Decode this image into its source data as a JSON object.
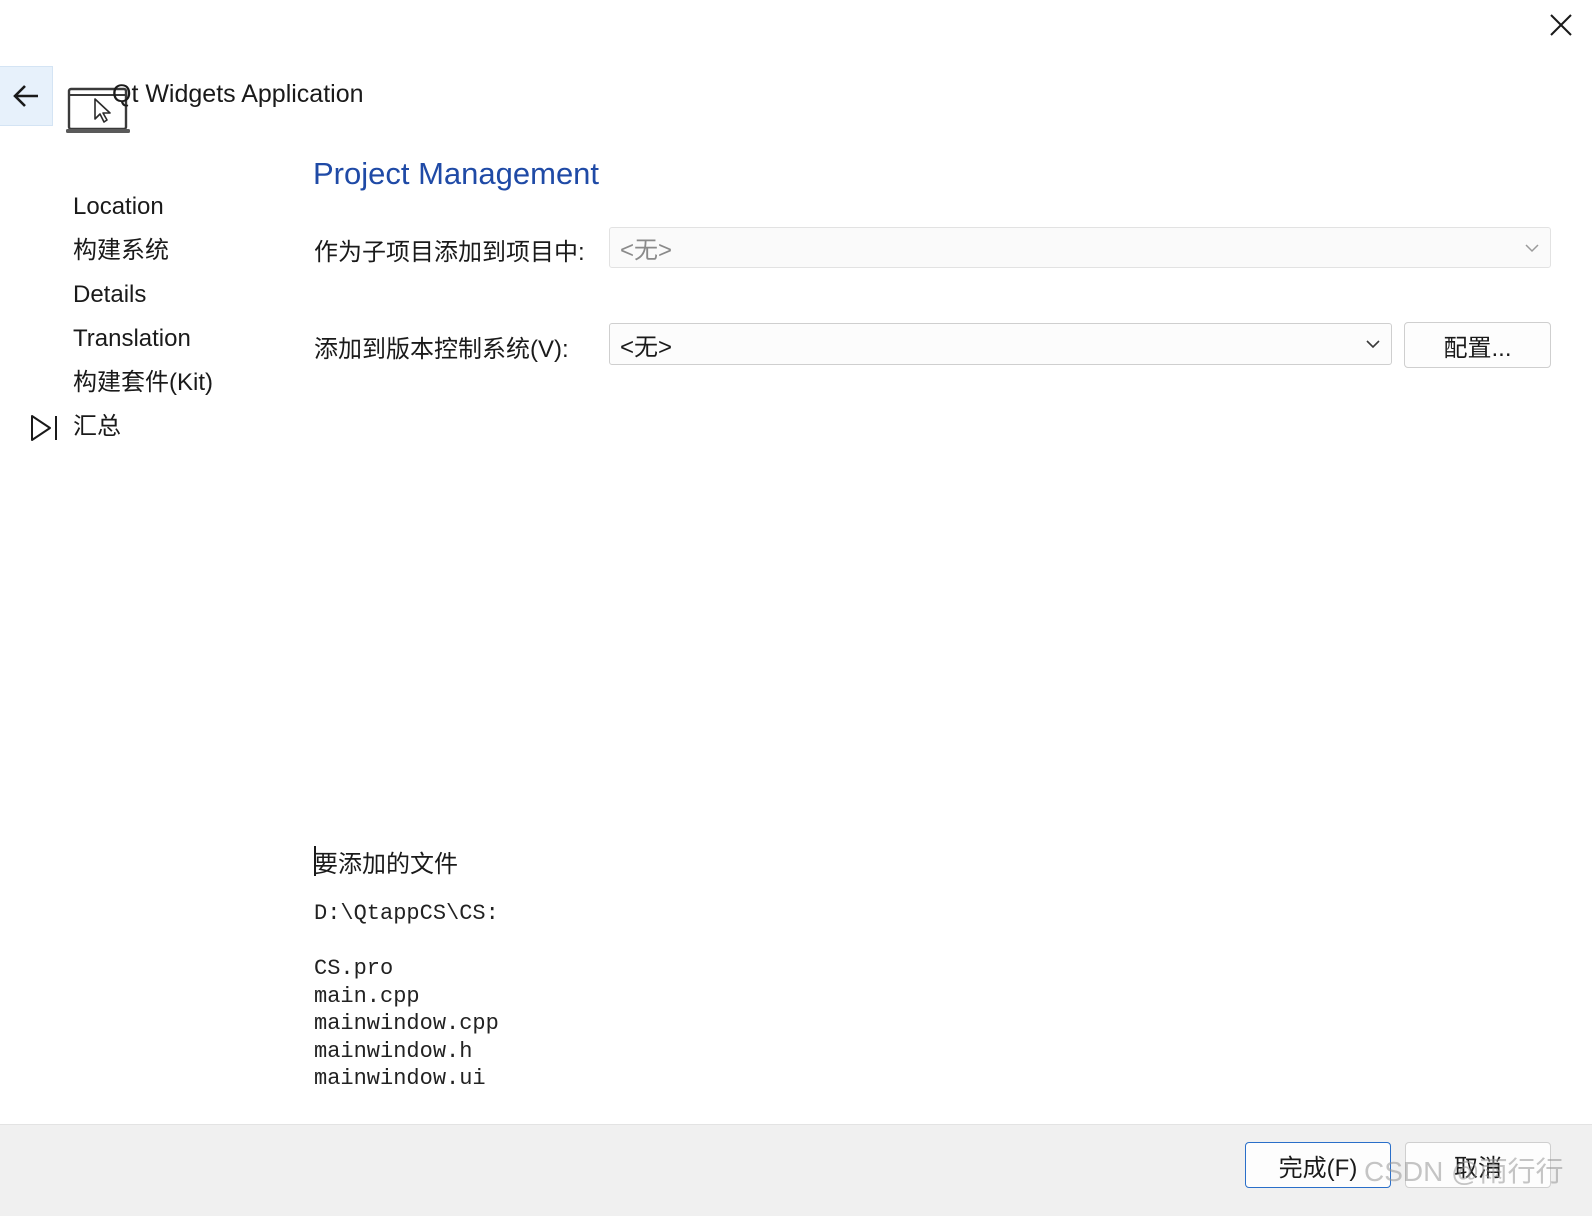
{
  "window": {
    "title": "Qt Widgets Application"
  },
  "icons": {
    "close": "close-icon",
    "back": "arrow-left-icon",
    "app": "desktop-application-icon",
    "step_marker": "current-step-arrow-icon",
    "chevron": "chevron-down-icon"
  },
  "steps": [
    {
      "label": "Location",
      "current": false
    },
    {
      "label": "构建系统",
      "current": false
    },
    {
      "label": "Details",
      "current": false
    },
    {
      "label": "Translation",
      "current": false
    },
    {
      "label": "构建套件(Kit)",
      "current": false
    },
    {
      "label": "汇总",
      "current": true
    }
  ],
  "page": {
    "title": "Project Management",
    "subproject": {
      "label": "作为子项目添加到项目中:",
      "value": "<无>",
      "enabled": false
    },
    "vcs": {
      "label": "添加到版本控制系统(V):",
      "value": "<无>",
      "configure_label": "配置..."
    },
    "files_heading": "要添加的文件",
    "files_text": "D:\\QtappCS\\CS:\n\nCS.pro\nmain.cpp\nmainwindow.cpp\nmainwindow.h\nmainwindow.ui"
  },
  "footer": {
    "finish_label": "完成(F)",
    "cancel_label": "取消"
  },
  "watermark": "CSDN @雨行行",
  "colors": {
    "accent": "#1f4aa6",
    "primary_border": "#2a6fc9",
    "back_button_bg": "#e7f1fb",
    "footer_bg": "#f0f0f0"
  }
}
